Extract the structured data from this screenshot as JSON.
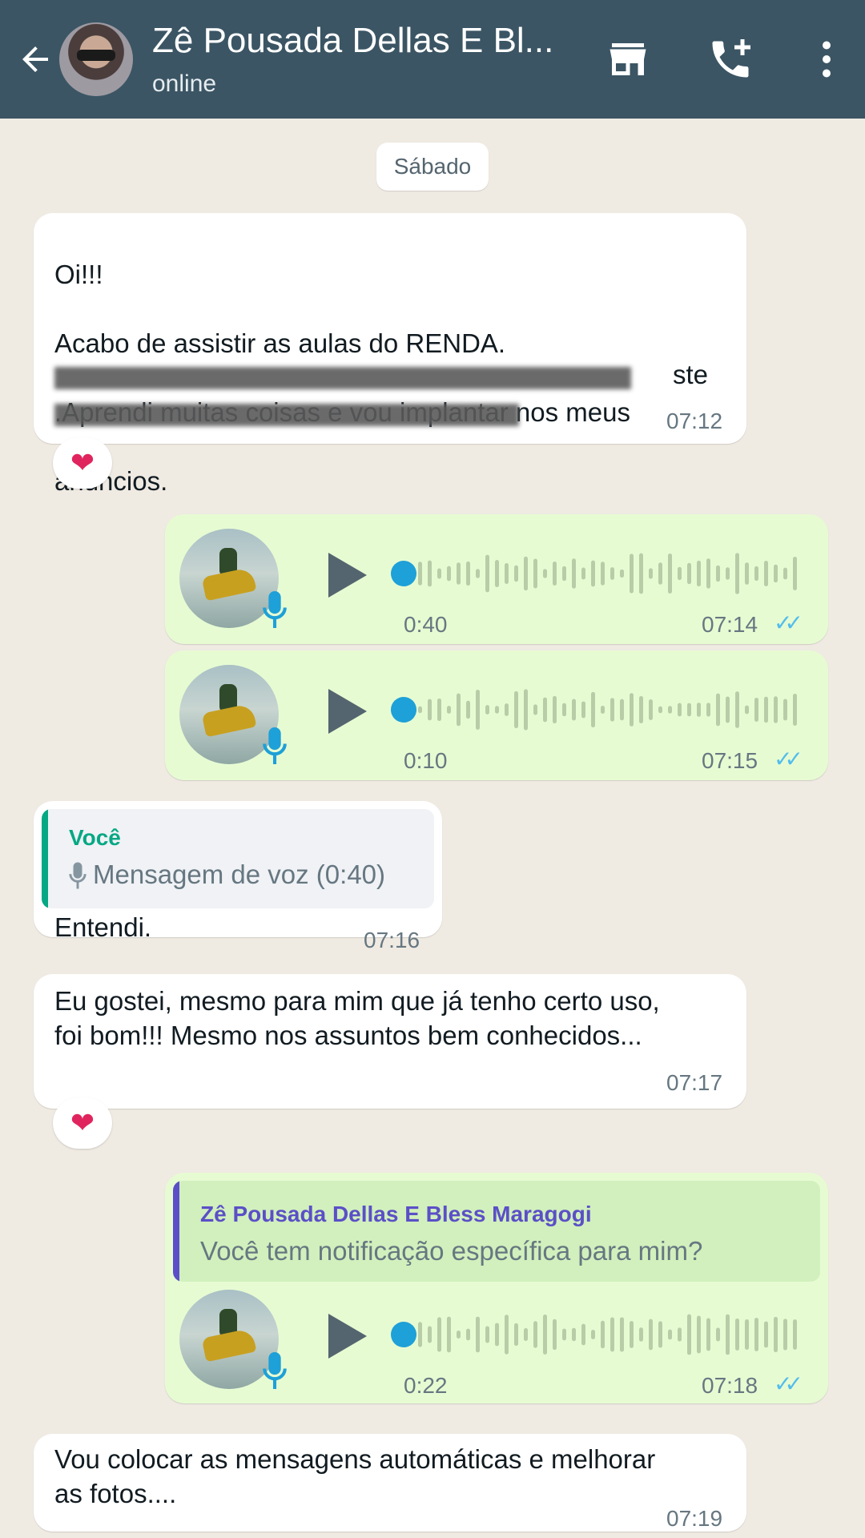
{
  "header": {
    "contact_name": "Zê Pousada Dellas E Bl...",
    "status": "online",
    "icons": [
      "back-arrow-icon",
      "store-icon",
      "add-call-icon",
      "more-vert-icon"
    ],
    "bg_color": "#3b5564"
  },
  "date_label": "Sábado",
  "messages": [
    {
      "id": "m1",
      "direction": "in",
      "lines": [
        "Oi!!!",
        "Acabo de assistir as aulas do RENDA.",
        ".Aprendi muitas coisas e vou implantar nos meus",
        "anúncios."
      ],
      "partial_text": "ste",
      "redacted": true,
      "time": "07:12",
      "reaction": "❤"
    },
    {
      "id": "m2",
      "direction": "out",
      "type": "voice",
      "duration": "0:40",
      "time": "07:14",
      "read": true
    },
    {
      "id": "m3",
      "direction": "out",
      "type": "voice",
      "duration": "0:10",
      "time": "07:15",
      "read": true
    },
    {
      "id": "m4",
      "direction": "in",
      "quote_author": "Você",
      "quote_text": "Mensagem de voz (0:40)",
      "text": "Entendi.",
      "time": "07:16"
    },
    {
      "id": "m5",
      "direction": "in",
      "text": "Eu gostei, mesmo para mim que já tenho certo uso,\nfoi bom!!! Mesmo nos assuntos bem conhecidos...",
      "time": "07:17",
      "reaction": "❤"
    },
    {
      "id": "m6",
      "direction": "out",
      "type": "voice",
      "quote_author": "Zê Pousada Dellas E Bless Maragogi",
      "quote_text": "Você tem notificação específica para mim?",
      "duration": "0:22",
      "time": "07:18",
      "read": true
    },
    {
      "id": "m7",
      "direction": "in",
      "text": "Vou colocar as mensagens automáticas e melhorar\nas fotos....",
      "time": "07:19"
    }
  ],
  "colors": {
    "incoming": "#ffffff",
    "outgoing": "#e7fbd3",
    "read_ticks": "#53bdeb",
    "quote_you": "#06a884",
    "quote_contact": "#5b4fc7"
  }
}
